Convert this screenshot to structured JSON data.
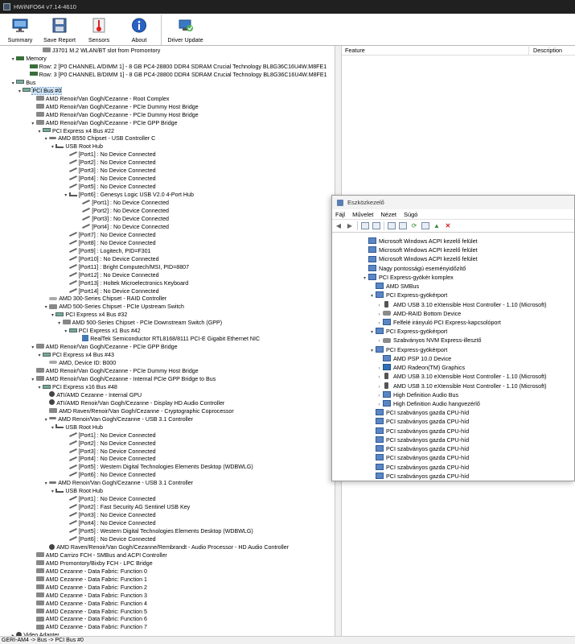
{
  "app": {
    "title": "HWiNFO64 v7.14-4610"
  },
  "toolbar": {
    "buttons": [
      {
        "label": "Summary",
        "icon": "summary-monitor-icon"
      },
      {
        "label": "Save Report",
        "icon": "save-disk-icon"
      },
      {
        "label": "Sensors",
        "icon": "sensors-gauge-icon"
      },
      {
        "label": "About",
        "icon": "about-info-icon"
      },
      {
        "label": "Driver Update",
        "icon": "driver-update-icon"
      }
    ]
  },
  "tree": {
    "rows": [
      {
        "text": "J3701 M.2 WLAN/BT slot from Promontory",
        "depth": 5,
        "exp": "",
        "icon": "chip"
      },
      {
        "text": "Memory",
        "depth": 1,
        "exp": "▾",
        "icon": "mem"
      },
      {
        "text": "Row: 2 [P0 CHANNEL A/DIMM 1] - 8 GB PC4-28800 DDR4 SDRAM Crucial Technology BL8G36C16U4W.M8FE1",
        "depth": 3,
        "exp": "",
        "icon": "mem"
      },
      {
        "text": "Row: 3 [P0 CHANNEL B/DIMM 1] - 8 GB PC4-28800 DDR4 SDRAM Crucial Technology BL8G36C16U4W.M8FE1",
        "depth": 3,
        "exp": "",
        "icon": "mem"
      },
      {
        "text": "Bus",
        "depth": 1,
        "exp": "▾",
        "icon": "bus"
      },
      {
        "text": "PCI Bus #0",
        "depth": 2,
        "exp": "▾",
        "icon": "bus",
        "selected": true
      },
      {
        "text": "AMD Renoir/Van Gogh/Cezanne - Root Complex",
        "depth": 4,
        "exp": "",
        "icon": "chip"
      },
      {
        "text": "AMD Renoir/Van Gogh/Cezanne - PCIe Dummy Host Bridge",
        "depth": 4,
        "exp": "",
        "icon": "chip"
      },
      {
        "text": "AMD Renoir/Van Gogh/Cezanne - PCIe Dummy Host Bridge",
        "depth": 4,
        "exp": "",
        "icon": "chip"
      },
      {
        "text": "AMD Renoir/Van Gogh/Cezanne - PCIe GPP Bridge",
        "depth": 4,
        "exp": "▾",
        "icon": "chip"
      },
      {
        "text": "PCI Express x4 Bus #22",
        "depth": 5,
        "exp": "▾",
        "icon": "bus"
      },
      {
        "text": "AMD B550 Chipset - USB Controller C",
        "depth": 6,
        "exp": "▾",
        "icon": "usb"
      },
      {
        "text": "USB Root Hub",
        "depth": 7,
        "exp": "▾",
        "icon": "usbhub"
      },
      {
        "text": "[Port1] : No Device Connected",
        "depth": 9,
        "exp": "",
        "icon": "port"
      },
      {
        "text": "[Port2] : No Device Connected",
        "depth": 9,
        "exp": "",
        "icon": "port"
      },
      {
        "text": "[Port3] : No Device Connected",
        "depth": 9,
        "exp": "",
        "icon": "port"
      },
      {
        "text": "[Port4] : No Device Connected",
        "depth": 9,
        "exp": "",
        "icon": "port"
      },
      {
        "text": "[Port5] : No Device Connected",
        "depth": 9,
        "exp": "",
        "icon": "port"
      },
      {
        "text": "[Port6] : Genesys Logic USB V2.0 4-Port Hub",
        "depth": 9,
        "exp": "▾",
        "icon": "usbhub"
      },
      {
        "text": "[Port1] : No Device Connected",
        "depth": 11,
        "exp": "",
        "icon": "port"
      },
      {
        "text": "[Port2] : No Device Connected",
        "depth": 11,
        "exp": "",
        "icon": "port"
      },
      {
        "text": "[Port3] : No Device Connected",
        "depth": 11,
        "exp": "",
        "icon": "port"
      },
      {
        "text": "[Port4] : No Device Connected",
        "depth": 11,
        "exp": "",
        "icon": "port"
      },
      {
        "text": "[Port7] : No Device Connected",
        "depth": 9,
        "exp": "",
        "icon": "port"
      },
      {
        "text": "[Port8] : No Device Connected",
        "depth": 9,
        "exp": "",
        "icon": "port"
      },
      {
        "text": "[Port9] : Logitech, PID=F301",
        "depth": 9,
        "exp": "",
        "icon": "port"
      },
      {
        "text": "[Port10] : No Device Connected",
        "depth": 9,
        "exp": "",
        "icon": "port"
      },
      {
        "text": "[Port11] : Bright Computech/MSI, PID=8807",
        "depth": 9,
        "exp": "",
        "icon": "port"
      },
      {
        "text": "[Port12] : No Device Connected",
        "depth": 9,
        "exp": "",
        "icon": "port"
      },
      {
        "text": "[Port13] : Holtek Microelectronics Keyboard",
        "depth": 9,
        "exp": "",
        "icon": "port"
      },
      {
        "text": "[Port14] : No Device Connected",
        "depth": 9,
        "exp": "",
        "icon": "port"
      },
      {
        "text": "AMD 300-Series Chipset - RAID Controller",
        "depth": 6,
        "exp": "",
        "icon": "disk"
      },
      {
        "text": "AMD 500-Series Chipset - PCIe Upstream Switch",
        "depth": 6,
        "exp": "▾",
        "icon": "chip"
      },
      {
        "text": "PCI Express x4 Bus #32",
        "depth": 7,
        "exp": "▾",
        "icon": "bus"
      },
      {
        "text": "AMD 500-Series Chipset - PCIe Downstream Switch (GPP)",
        "depth": 8,
        "exp": "▾",
        "icon": "chip"
      },
      {
        "text": "PCI Express x1 Bus #42",
        "depth": 9,
        "exp": "▾",
        "icon": "bus"
      },
      {
        "text": "RealTek Semiconductor RTL8168/8111 PCI-E Gigabit Ethernet NIC",
        "depth": 11,
        "exp": "",
        "icon": "net"
      },
      {
        "text": "AMD Renoir/Van Gogh/Cezanne - PCIe GPP Bridge",
        "depth": 4,
        "exp": "▾",
        "icon": "chip"
      },
      {
        "text": "PCI Express x4 Bus #43",
        "depth": 5,
        "exp": "▾",
        "icon": "bus"
      },
      {
        "text": "AMD, Device ID: B000",
        "depth": 6,
        "exp": "",
        "icon": "disk"
      },
      {
        "text": "AMD Renoir/Van Gogh/Cezanne - PCIe Dummy Host Bridge",
        "depth": 4,
        "exp": "",
        "icon": "chip"
      },
      {
        "text": "AMD Renoir/Van Gogh/Cezanne - Internal PCIe GPP Bridge to Bus",
        "depth": 4,
        "exp": "▾",
        "icon": "chip"
      },
      {
        "text": "PCI Express x16 Bus #48",
        "depth": 5,
        "exp": "▾",
        "icon": "bus"
      },
      {
        "text": "ATI/AMD Cezanne - Internal GPU",
        "depth": 6,
        "exp": "",
        "icon": "gpu"
      },
      {
        "text": "ATI/AMD Renoir/Van Gogh/Cezanne - Display HD Audio Controller",
        "depth": 6,
        "exp": "",
        "icon": "gpu"
      },
      {
        "text": "AMD Raven/Renoir/Van Gogh/Cezanne - Cryptographic Coprocessor",
        "depth": 6,
        "exp": "",
        "icon": "chip"
      },
      {
        "text": "AMD Renoir/Van Gogh/Cezanne - USB 3.1 Controller",
        "depth": 6,
        "exp": "▾",
        "icon": "usb"
      },
      {
        "text": "USB Root Hub",
        "depth": 7,
        "exp": "▾",
        "icon": "usbhub"
      },
      {
        "text": "[Port1] : No Device Connected",
        "depth": 9,
        "exp": "",
        "icon": "port"
      },
      {
        "text": "[Port2] : No Device Connected",
        "depth": 9,
        "exp": "",
        "icon": "port"
      },
      {
        "text": "[Port3] : No Device Connected",
        "depth": 9,
        "exp": "",
        "icon": "port"
      },
      {
        "text": "[Port4] : No Device Connected",
        "depth": 9,
        "exp": "",
        "icon": "port"
      },
      {
        "text": "[Port5] : Western Digital Technologies Elements Desktop (WDBWLG)",
        "depth": 9,
        "exp": "",
        "icon": "port"
      },
      {
        "text": "[Port6] : No Device Connected",
        "depth": 9,
        "exp": "",
        "icon": "port"
      },
      {
        "text": "AMD Renoir/Van Gogh/Cezanne - USB 3.1 Controller",
        "depth": 6,
        "exp": "▾",
        "icon": "usb"
      },
      {
        "text": "USB Root Hub",
        "depth": 7,
        "exp": "▾",
        "icon": "usbhub"
      },
      {
        "text": "[Port1] : No Device Connected",
        "depth": 9,
        "exp": "",
        "icon": "port"
      },
      {
        "text": "[Port2] : Fast Security AG Sentinel USB Key",
        "depth": 9,
        "exp": "",
        "icon": "port"
      },
      {
        "text": "[Port3] : No Device Connected",
        "depth": 9,
        "exp": "",
        "icon": "port"
      },
      {
        "text": "[Port4] : No Device Connected",
        "depth": 9,
        "exp": "",
        "icon": "port"
      },
      {
        "text": "[Port5] : Western Digital Technologies Elements Desktop (WDBWLG)",
        "depth": 9,
        "exp": "",
        "icon": "port"
      },
      {
        "text": "[Port6] : No Device Connected",
        "depth": 9,
        "exp": "",
        "icon": "port"
      },
      {
        "text": "AMD Raven/Renoir/Van Gogh/Cezanne/Rembrandt - Audio Processor - HD Audio Controller",
        "depth": 6,
        "exp": "",
        "icon": "gpu"
      },
      {
        "text": "AMD Carrizo FCH - SMBus and ACPI Controller",
        "depth": 4,
        "exp": "",
        "icon": "chip"
      },
      {
        "text": "AMD Promontory/Bixby FCH - LPC Bridge",
        "depth": 4,
        "exp": "",
        "icon": "chip"
      },
      {
        "text": "AMD Cezanne - Data Fabric: Function 0",
        "depth": 4,
        "exp": "",
        "icon": "chip"
      },
      {
        "text": "AMD Cezanne - Data Fabric: Function 1",
        "depth": 4,
        "exp": "",
        "icon": "chip"
      },
      {
        "text": "AMD Cezanne - Data Fabric: Function 2",
        "depth": 4,
        "exp": "",
        "icon": "chip"
      },
      {
        "text": "AMD Cezanne - Data Fabric: Function 3",
        "depth": 4,
        "exp": "",
        "icon": "chip"
      },
      {
        "text": "AMD Cezanne - Data Fabric: Function 4",
        "depth": 4,
        "exp": "",
        "icon": "chip"
      },
      {
        "text": "AMD Cezanne - Data Fabric: Function 5",
        "depth": 4,
        "exp": "",
        "icon": "chip"
      },
      {
        "text": "AMD Cezanne - Data Fabric: Function 6",
        "depth": 4,
        "exp": "",
        "icon": "chip"
      },
      {
        "text": "AMD Cezanne - Data Fabric: Function 7",
        "depth": 4,
        "exp": "",
        "icon": "chip"
      },
      {
        "text": "Video Adapter",
        "depth": 1,
        "exp": "▸",
        "icon": "gpu"
      }
    ]
  },
  "rightpane": {
    "col_feature": "Feature",
    "col_description": "Description"
  },
  "statusbar": {
    "text": "GERI-AM4 -> Bus -> PCI Bus #0"
  },
  "devmgr": {
    "title": "Eszközkezelő",
    "menu": [
      "Fájl",
      "Művelet",
      "Nézet",
      "Súgó"
    ],
    "rows": [
      {
        "text": "Microsoft Windows ACPI kezelő felület",
        "depth": 4,
        "exp": "",
        "icon": "sys"
      },
      {
        "text": "Microsoft Windows ACPI kezelő felület",
        "depth": 4,
        "exp": "",
        "icon": "sys"
      },
      {
        "text": "Microsoft Windows ACPI kezelő felület",
        "depth": 4,
        "exp": "",
        "icon": "sys"
      },
      {
        "text": "Nagy pontosságú eseményidőzítő",
        "depth": 4,
        "exp": "",
        "icon": "sys"
      },
      {
        "text": "PCI Express-gyökér komplex",
        "depth": 4,
        "exp": "▾",
        "icon": "sys"
      },
      {
        "text": "AMD SMBus",
        "depth": 5,
        "exp": "",
        "icon": "sys"
      },
      {
        "text": "PCI Express-gyökérport",
        "depth": 5,
        "exp": "▾",
        "icon": "sys"
      },
      {
        "text": "AMD USB 3.10 eXtensible Host Controller - 1.10 (Microsoft)",
        "depth": 6,
        "exp": "›",
        "icon": "usb"
      },
      {
        "text": "AMD-RAID Bottom Device",
        "depth": 6,
        "exp": "›",
        "icon": "disk"
      },
      {
        "text": "Felfelé irányuló PCI Express-kapcsolóport",
        "depth": 6,
        "exp": "›",
        "icon": "sys"
      },
      {
        "text": "PCI Express-gyökérport",
        "depth": 5,
        "exp": "▾",
        "icon": "sys"
      },
      {
        "text": "Szabványos NVM Express-illesztő",
        "depth": 6,
        "exp": "›",
        "icon": "disk"
      },
      {
        "text": "PCI Express-gyökérport",
        "depth": 5,
        "exp": "▾",
        "icon": "sys"
      },
      {
        "text": "AMD PSP 10.0 Device",
        "depth": 6,
        "exp": "",
        "icon": "sys"
      },
      {
        "text": "AMD Radeon(TM) Graphics",
        "depth": 6,
        "exp": "›",
        "icon": "mon"
      },
      {
        "text": "AMD USB 3.10 eXtensible Host Controller - 1.10 (Microsoft)",
        "depth": 6,
        "exp": "›",
        "icon": "usb"
      },
      {
        "text": "AMD USB 3.10 eXtensible Host Controller - 1.10 (Microsoft)",
        "depth": 6,
        "exp": "›",
        "icon": "usb"
      },
      {
        "text": "High Definition Audio Bus",
        "depth": 6,
        "exp": "›",
        "icon": "sys"
      },
      {
        "text": "High Definition Audio hangvezérlő",
        "depth": 6,
        "exp": "›",
        "icon": "sys"
      },
      {
        "text": "PCI szabványos gazda CPU-híd",
        "depth": 5,
        "exp": "",
        "icon": "sys"
      },
      {
        "text": "PCI szabványos gazda CPU-híd",
        "depth": 5,
        "exp": "",
        "icon": "sys"
      },
      {
        "text": "PCI szabványos gazda CPU-híd",
        "depth": 5,
        "exp": "",
        "icon": "sys"
      },
      {
        "text": "PCI szabványos gazda CPU-híd",
        "depth": 5,
        "exp": "",
        "icon": "sys"
      },
      {
        "text": "PCI szabványos gazda CPU-híd",
        "depth": 5,
        "exp": "",
        "icon": "sys"
      },
      {
        "text": "PCI szabványos gazda CPU-híd",
        "depth": 5,
        "exp": "",
        "icon": "sys"
      },
      {
        "text": "PCI szabványos gazda CPU-híd",
        "depth": 5,
        "exp": "",
        "icon": "sys"
      },
      {
        "text": "PCI szabványos gazda CPU-híd",
        "depth": 5,
        "exp": "",
        "icon": "sys"
      }
    ]
  }
}
